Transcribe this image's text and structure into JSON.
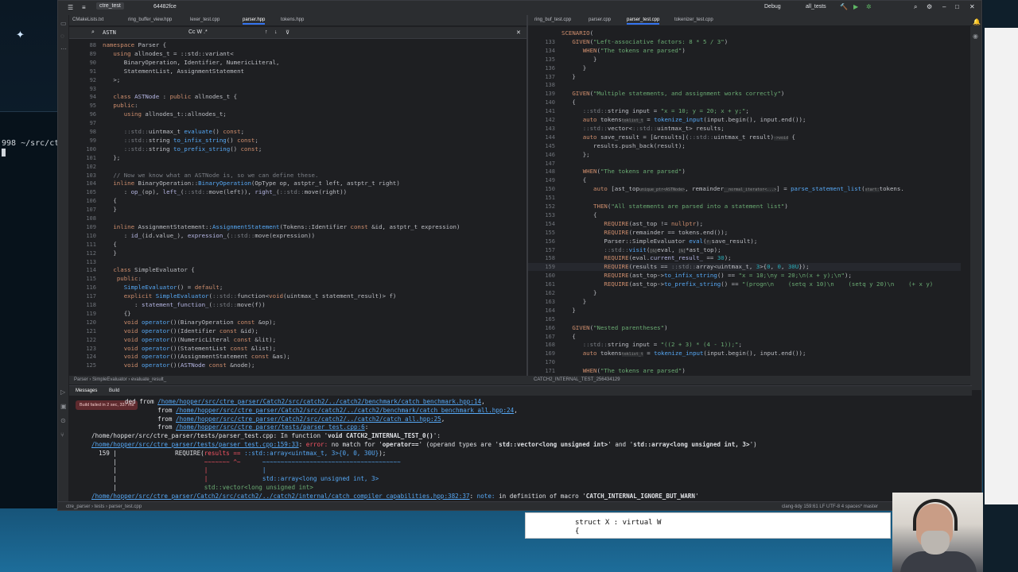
{
  "colors": {
    "accent": "#3574f0",
    "error": "#f75464",
    "link": "#56a8f5"
  },
  "terminal": {
    "lines": [
      "998 ~/src/ct",
      ""
    ]
  },
  "titlebar": {
    "project": "ctre_test",
    "branch": "64482fce",
    "config": "Debug",
    "target": "all_tests"
  },
  "left_tabs": [
    "CMakeLists.txt",
    "ring_buffer_view.hpp",
    "lexer_test.cpp",
    "parser.hpp",
    "tokens.hpp"
  ],
  "right_tabs": [
    "ring_buf_test.cpp",
    "parser.cpp",
    "parser_test.cpp",
    "tokenizer_test.cpp"
  ],
  "search": {
    "value": "ASTN",
    "options": "Cc  W  .*",
    "count": ""
  },
  "left_editor": {
    "lines": [
      {
        "n": "88",
        "h": "<span class='k'>namespace</span> Parser {"
      },
      {
        "n": "89",
        "h": "   <span class='k'>using</span> allnodes_t = ::std::variant&lt;"
      },
      {
        "n": "90",
        "h": "      BinaryOperation, Identifier, NumericLiteral,"
      },
      {
        "n": "91",
        "h": "      StatementList, AssignmentStatement"
      },
      {
        "n": "92",
        "h": "   &gt;;"
      },
      {
        "n": "93",
        "h": ""
      },
      {
        "n": "94",
        "h": "   <span class='k'>class</span> <span class='t'>ASTNode</span> : <span class='k'>public</span> allnodes_t {"
      },
      {
        "n": "95",
        "h": "   <span class='k'>public</span>:"
      },
      {
        "n": "96",
        "h": "      <span class='k'>using</span> allnodes_t::allnodes_t;"
      },
      {
        "n": "97",
        "h": ""
      },
      {
        "n": "98",
        "h": "      <span class='c'>::std::</span>uintmax_t <span class='f'>evaluate</span>() <span class='k'>const</span>;"
      },
      {
        "n": "99",
        "h": "      <span class='c'>::std::</span>string <span class='f'>to_infix_string</span>() <span class='k'>const</span>;"
      },
      {
        "n": "100",
        "h": "      <span class='c'>::std::</span>string <span class='f'>to_prefix_string</span>() <span class='k'>const</span>;"
      },
      {
        "n": "101",
        "h": "   };"
      },
      {
        "n": "102",
        "h": ""
      },
      {
        "n": "103",
        "h": "   <span class='c'>// Now we know what an ASTNode is, so we can define these.</span>"
      },
      {
        "n": "104",
        "h": "   <span class='k'>inline</span> BinaryOperation::<span class='f'>BinaryOperation</span>(OpType op, astptr_t left, astptr_t right)"
      },
      {
        "n": "105",
        "h": "      : <span class='t'>op_</span>(op), <span class='t'>left_</span>(<span class='c'>::std::</span>move(left)), <span class='t'>right_</span>(<span class='c'>::std::</span>move(right))"
      },
      {
        "n": "106",
        "h": "   {"
      },
      {
        "n": "107",
        "h": "   }"
      },
      {
        "n": "108",
        "h": ""
      },
      {
        "n": "109",
        "h": "   <span class='k'>inline</span> AssignmentStatement::<span class='f'>AssignmentStatement</span>(Tokens::Identifier <span class='k'>const</span> &amp;id, astptr_t expression)"
      },
      {
        "n": "110",
        "h": "      : <span class='t'>id_</span>(id.value_), <span class='t'>expression_</span>(<span class='c'>::std::</span>move(expression))"
      },
      {
        "n": "111",
        "h": "   {"
      },
      {
        "n": "112",
        "h": "   }"
      },
      {
        "n": "113",
        "h": ""
      },
      {
        "n": "114",
        "h": "   <span class='k'>class</span> SimpleEvaluator {"
      },
      {
        "n": "115",
        "h": "    <span class='k'>public</span>:"
      },
      {
        "n": "116",
        "h": "      <span class='f'>SimpleEvaluator</span>() = <span class='k'>default</span>;"
      },
      {
        "n": "117",
        "h": "      <span class='k'>explicit</span> <span class='f'>SimpleEvaluator</span>(<span class='c'>::std::</span>function&lt;<span class='k'>void</span>(uintmax_t statement_result)&gt; f)"
      },
      {
        "n": "118",
        "h": "         : <span class='t'>statement_function_</span>(<span class='c'>::std::</span>move(f))"
      },
      {
        "n": "119",
        "h": "      {}"
      },
      {
        "n": "120",
        "h": "      <span class='k'>void</span> <span class='f'>operator</span>()(BinaryOperation <span class='k'>const</span> &amp;op);"
      },
      {
        "n": "121",
        "h": "      <span class='k'>void</span> <span class='f'>operator</span>()(Identifier <span class='k'>const</span> &amp;id);"
      },
      {
        "n": "122",
        "h": "      <span class='k'>void</span> <span class='f'>operator</span>()(NumericLiteral <span class='k'>const</span> &amp;lit);"
      },
      {
        "n": "123",
        "h": "      <span class='k'>void</span> <span class='f'>operator</span>()(StatementList <span class='k'>const</span> &amp;list);"
      },
      {
        "n": "124",
        "h": "      <span class='k'>void</span> <span class='f'>operator</span>()(AssignmentStatement <span class='k'>const</span> &amp;as);"
      },
      {
        "n": "125",
        "h": "      <span class='k'>void</span> <span class='f'>operator</span>()(<span class='t'>ASTNode</span> <span class='k'>const</span> &amp;node);"
      }
    ]
  },
  "right_editor": {
    "lines": [
      {
        "n": "",
        "h": "<span class='k'>SCENARIO</span>("
      },
      {
        "n": "133",
        "h": "   <span class='k'>GIVEN</span>(<span class='s'>\"Left-associative factors: 8 * 5 / 3\"</span>)"
      },
      {
        "n": "134",
        "h": "      <span class='k'>WHEN</span>(<span class='s'>\"The tokens are parsed\"</span>)"
      },
      {
        "n": "135",
        "h": "         }"
      },
      {
        "n": "136",
        "h": "      }"
      },
      {
        "n": "137",
        "h": "   }"
      },
      {
        "n": "138",
        "h": ""
      },
      {
        "n": "139",
        "h": "   <span class='k'>GIVEN</span>(<span class='s'>\"Multiple statements, and assignment works correctly\"</span>)"
      },
      {
        "n": "140",
        "h": "   {"
      },
      {
        "n": "141",
        "h": "      <span class='c'>::std::</span>string input = <span class='s'>\"x = 10; y = 20; x + y;\"</span>;"
      },
      {
        "n": "142",
        "h": "      <span class='k'>auto</span> tokens<span class='h'>toklist_t</span> = <span class='f'>tokenize_input</span>(input.begin(), input.end());"
      },
      {
        "n": "143",
        "h": "      <span class='c'>::std::</span>vector&lt;<span class='c'>::std::</span>uintmax_t&gt; results;"
      },
      {
        "n": "144",
        "h": "      <span class='k'>auto</span> save_result = [&amp;results](<span class='c'>::std::</span>uintmax_t result)<span class='h'>-&gt;void</span> {"
      },
      {
        "n": "145",
        "h": "         results.push_back(result);"
      },
      {
        "n": "146",
        "h": "      };"
      },
      {
        "n": "147",
        "h": ""
      },
      {
        "n": "148",
        "h": "      <span class='k'>WHEN</span>(<span class='s'>\"The tokens are parsed\"</span>)"
      },
      {
        "n": "149",
        "h": "      {"
      },
      {
        "n": "150",
        "h": "         <span class='k'>auto</span> [ast_top<span class='h'>unique_ptr&lt;ASTNode&gt;</span>, remainder<span class='h'>__normal_iterator&lt;...&gt;</span>] = <span class='f'>parse_statement_list</span>(<span class='h'>start:</span>tokens."
      },
      {
        "n": "151",
        "h": ""
      },
      {
        "n": "152",
        "h": "         <span class='k'>THEN</span>(<span class='s'>\"All statements are parsed into a statement list\"</span>)"
      },
      {
        "n": "153",
        "h": "         {"
      },
      {
        "n": "154",
        "h": "            <span class='k'>REQUIRE</span>(ast_top != <span class='k'>nullptr</span>);"
      },
      {
        "n": "155",
        "h": "            <span class='k'>REQUIRE</span>(remainder == tokens.end());"
      },
      {
        "n": "156",
        "h": "            Parser::SimpleEvaluator <span class='f'>eval</span>(<span class='h'>f:</span>save_result);"
      },
      {
        "n": "157",
        "h": "            <span class='c'>::std::</span><span class='f'>visit</span>(<span class='h'>[&amp;]</span>eval, <span class='h'>[&amp;]</span>*ast_top);"
      },
      {
        "n": "158",
        "h": "            <span class='k'>REQUIRE</span>(eval.<span class='t'>current_result_</span> == <span class='n'>30</span>);"
      },
      {
        "n": "159",
        "h": "            <span class='k'>REQUIRE</span>(results == <span class='c'>::std::</span>array&lt;uintmax_t, <span class='n'>3</span>&gt;{<span class='n'>0</span>, <span class='n'>0</span>, <span class='n'>30U</span>});"
      },
      {
        "n": "160",
        "h": "            <span class='k'>REQUIRE</span>(ast_top-&gt;<span class='f'>to_infix_string</span>() == <span class='s'>\"x = 10;\\ny = 20;\\n(x + y);\\n\"</span>);"
      },
      {
        "n": "161",
        "h": "            <span class='k'>REQUIRE</span>(ast_top-&gt;<span class='f'>to_prefix_string</span>() == <span class='s'>\"(progn\\n    (setq x 10)\\n    (setq y 20)\\n    (+ x y)</span>"
      },
      {
        "n": "162",
        "h": "         }"
      },
      {
        "n": "163",
        "h": "      }"
      },
      {
        "n": "164",
        "h": "   }"
      },
      {
        "n": "165",
        "h": ""
      },
      {
        "n": "166",
        "h": "   <span class='k'>GIVEN</span>(<span class='s'>\"Nested parentheses\"</span>)"
      },
      {
        "n": "167",
        "h": "   {"
      },
      {
        "n": "168",
        "h": "      <span class='c'>::std::</span>string input = <span class='s'>\"((2 + 3) * (4 - 1));\"</span>;"
      },
      {
        "n": "169",
        "h": "      <span class='k'>auto</span> tokens<span class='h'>toklist_t</span> = <span class='f'>tokenize_input</span>(input.begin(), input.end());"
      },
      {
        "n": "170",
        "h": ""
      },
      {
        "n": "171",
        "h": "      <span class='k'>WHEN</span>(<span class='s'>\"The tokens are parsed\"</span>)"
      }
    ]
  },
  "editor_status": {
    "left": "Parser  ›  SimpleEvaluator  ›  evaluate_result_",
    "right": "CATCH2_INTERNAL_TEST_256434129"
  },
  "messages": {
    "tabs": [
      "Messages",
      "Build"
    ],
    "build_failed": "Build failed in 2 sec, 337 ms",
    "lines": [
      {
        "h": "ded from <a>/home/hopper/src/ctre_parser/Catch2/src/catch2/../catch2/benchmark/catch_benchmark.hpp:14</a>,"
      },
      {
        "h": "         from <a>/home/hopper/src/ctre_parser/Catch2/src/catch2/../catch2/benchmark/catch_benchmark_all.hpp:24</a>,"
      },
      {
        "h": "         from <a>/home/hopper/src/ctre_parser/Catch2/src/catch2/../catch2/catch_all.hpp:25</a>,"
      },
      {
        "h": "         from <a>/home/hopper/src/ctre_parser/tests/parser_test.cpp:6</a>:"
      },
      {
        "h": "/home/hopper/src/ctre_parser/tests/parser_test.cpp: In function '<b>void CATCH2_INTERNAL_TEST_0()</b>':"
      },
      {
        "h": "<a>/home/hopper/src/ctre_parser/tests/parser_test.cpp:159:33</a>: <span class='er'>error:</span> no match for '<b>operator==</b>' (operand types are '<b>std::vector&lt;long unsigned int&gt;</b>' and '<b>std::array&lt;long unsigned int, 3&gt;</b>')"
      },
      {
        "h": "  159 |                REQUIRE(<span class='er'>results</span> <span class='er'>==</span> <span class='bl'>::std::array&lt;uintmax_t, 3&gt;{0, 0, 30U}</span>);"
      },
      {
        "h": "      |                        <span class='er'>~~~~~~~</span> <span class='er'>^~</span>      <span class='bl'>~~~~~~~~~~~~~~~~~~~~~~~~~~~~~~~~~~~~~~</span>"
      },
      {
        "h": "      |                        <span class='er'>|</span>               <span class='bl'>|</span>"
      },
      {
        "h": "      |                        <span class='er'>|</span>               <span class='bl'>std::array&lt;long unsigned int, 3&gt;</span>"
      },
      {
        "h": "      |                        <span class='gr'>std::vector&lt;long unsigned int&gt;</span>"
      },
      {
        "h": "<a>/home/hopper/src/ctre_parser/Catch2/src/catch2/../catch2/internal/catch_compiler_capabilities.hpp:382:37</a>: <span class='bl'>note:</span> in definition of macro '<b>CATCH_INTERNAL_IGNORE_BUT_WARN</b>'"
      }
    ]
  },
  "statusbar": {
    "breadcrumb": "ctre_parser  ›  tests  ›  parser_test.cpp",
    "right": "clang-tidy    159:61    LF    UTF-8    4 spaces*    master"
  },
  "popup": {
    "lines": [
      "struct X : virtual W",
      "{"
    ]
  }
}
